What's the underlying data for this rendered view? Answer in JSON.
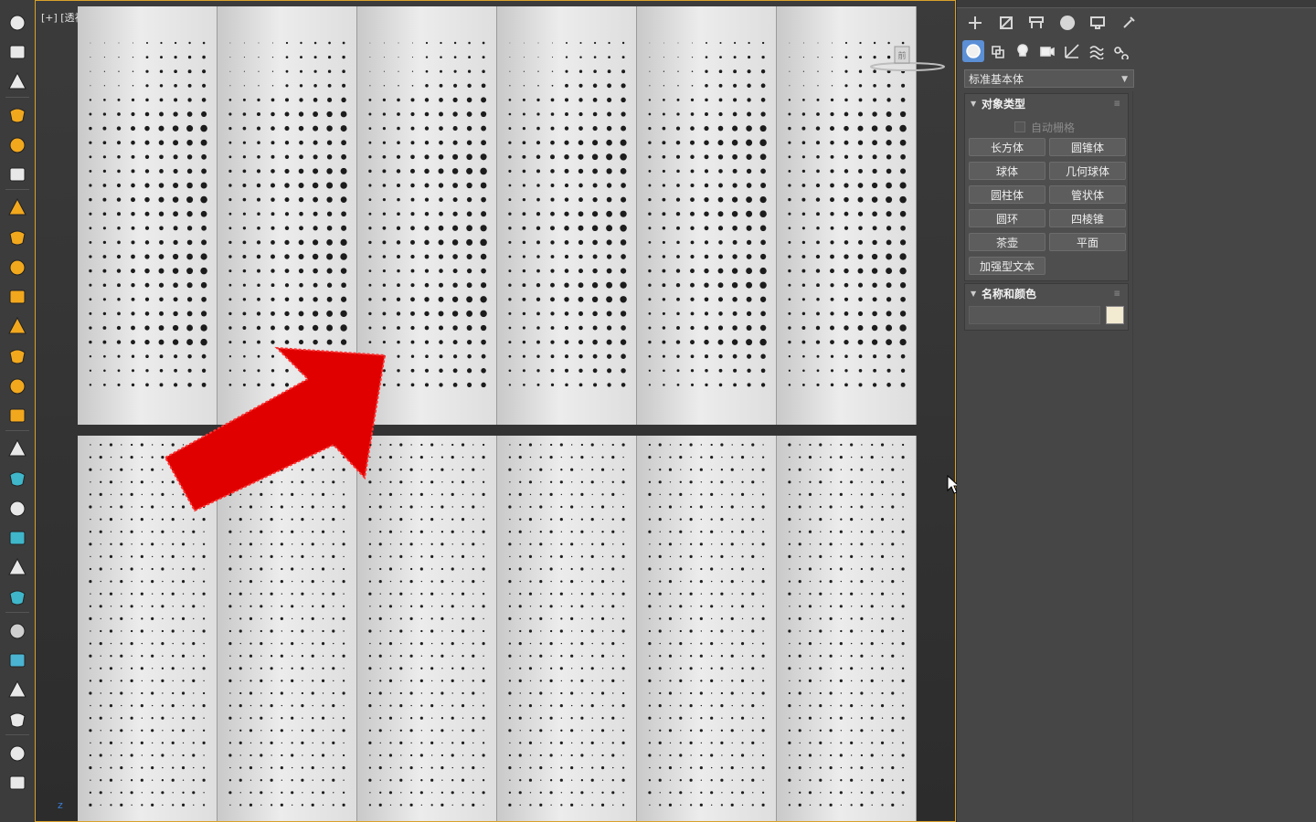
{
  "viewport": {
    "label": "[+] [透视] [注版] [默认明暗处理]",
    "axis_label": "z"
  },
  "toolbar_icons": [
    "teapot-icon",
    "torus-knot-icon",
    "box-window-icon",
    "display-icon",
    "render-frame-icon",
    "camera-icon",
    "funnel-icon",
    "half-sphere-icon",
    "sphere-icon",
    "geosphere-icon",
    "mushroom-icon",
    "lightbulb-icon",
    "sun-icon",
    "sunburst-icon",
    "cube-icon",
    "sphere-wrap-icon",
    "pyramid-icon",
    "array-icon",
    "grass-icon",
    "flame-icon",
    "material-ball-icon",
    "palette-icon",
    "color-wheel-icon",
    "slate-icon",
    "render-setup-icon",
    "v-ray-icon"
  ],
  "command_panel": {
    "tabs": [
      "create-tab",
      "modify-tab",
      "hierarchy-tab",
      "motion-tab",
      "display-tab",
      "utilities-tab"
    ],
    "subcategories": [
      "geometry-icon",
      "shapes-icon",
      "lights-icon",
      "cameras-icon",
      "helpers-icon",
      "space-warps-icon",
      "systems-icon"
    ],
    "category_dropdown": "标准基本体",
    "rollout_object_type": {
      "title": "对象类型",
      "autogrid": "自动栅格",
      "buttons": [
        "长方体",
        "圆锥体",
        "球体",
        "几何球体",
        "圆柱体",
        "管状体",
        "圆环",
        "四棱锥",
        "茶壶",
        "平面",
        "加强型文本"
      ]
    },
    "rollout_name_color": {
      "title": "名称和颜色",
      "name_value": "",
      "color": "#f3ead2"
    }
  },
  "colors": {
    "viewport_border": "#d8a12a",
    "arrow": "#e00000",
    "active_sub": "#5b8fd6"
  }
}
